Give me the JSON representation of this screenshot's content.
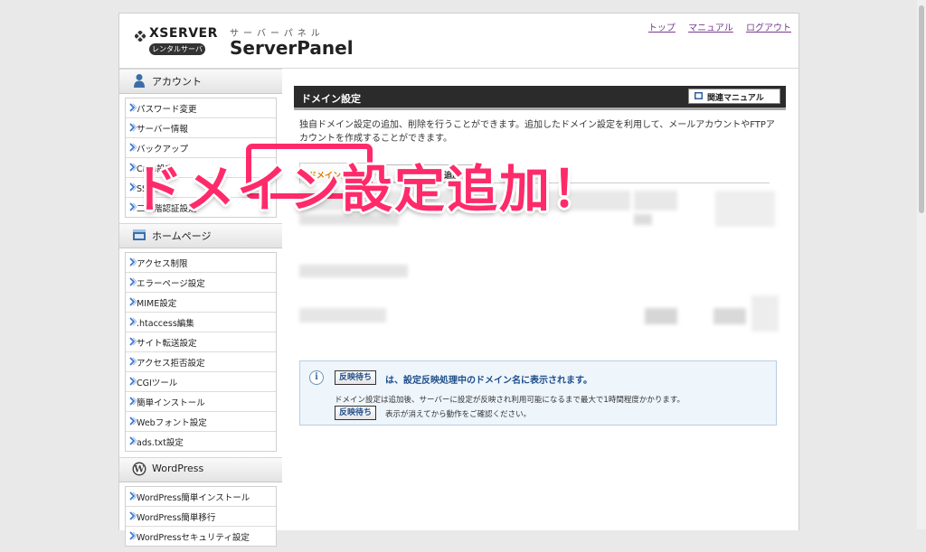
{
  "header": {
    "brand": "XSERVER",
    "brand_badge": "レンタルサーバー",
    "panel_sub": "サーバーパネル",
    "panel_title": "ServerPanel",
    "links": [
      "トップ",
      "マニュアル",
      "ログアウト"
    ]
  },
  "sidebar": {
    "sections": [
      {
        "title": "アカウント",
        "icon": "person-icon",
        "items": [
          "パスワード変更",
          "サーバー情報",
          "バックアップ",
          "Cron設定",
          "SSH設定",
          "二段階認証設定"
        ]
      },
      {
        "title": "ホームページ",
        "icon": "homepage-icon",
        "items": [
          "アクセス制限",
          "エラーページ設定",
          "MIME設定",
          ".htaccess編集",
          "サイト転送設定",
          "アクセス拒否設定",
          "CGIツール",
          "簡単インストール",
          "Webフォント設定",
          "ads.txt設定"
        ]
      },
      {
        "title": "WordPress",
        "icon": "wordpress-icon",
        "items": [
          "WordPress簡単インストール",
          "WordPress簡単移行",
          "WordPressセキュリティ設定"
        ]
      }
    ]
  },
  "main": {
    "title": "ドメイン設定",
    "manual_button": "関連マニュアル",
    "description_1": "独自ドメイン設定の追加、削除を行うことができます。追加したドメイン設定を利用して、メールアカウントやFTPア",
    "description_2": "カウントを作成することができます。",
    "tabs": {
      "active": "ドメイン設定一",
      "add": "ドメイン設定追加"
    },
    "annotation": "ドメイン設定追加！",
    "info": {
      "badge": "反映待ち",
      "main_text": "は、設定反映処理中のドメイン名に表示されます。",
      "detail_1": "ドメイン設定は追加後、サーバーに設定が反映され利用可能になるまで最大で1時間程度かかります。",
      "detail_2": "表示が消えてから動作をご確認ください。"
    }
  },
  "colors": {
    "highlight": "#ff2a6a",
    "tab_active": "#e57900",
    "title_bar": "#2b2b2b",
    "info_text": "#1f4e8a"
  }
}
